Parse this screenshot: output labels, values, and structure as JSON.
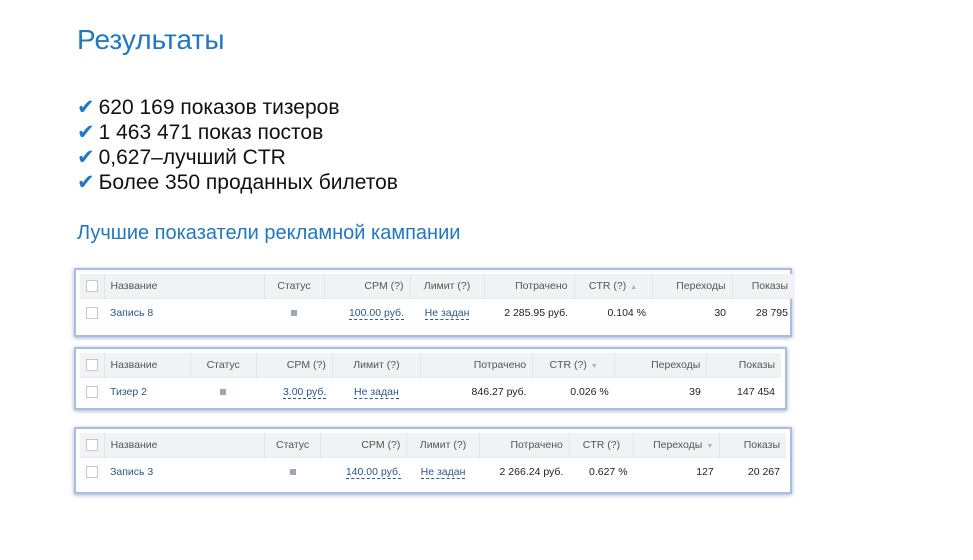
{
  "title": "Результаты",
  "bullets": [
    "620 169 показов тизеров",
    "1 463 471 показ постов",
    "0,627–лучший CTR",
    "Более 350 проданных билетов"
  ],
  "check_glyph": "✔",
  "subtitle": "Лучшие показатели рекламной кампании",
  "colors": {
    "accent": "#1f78c1",
    "link": "#2a5885",
    "panel_border": "#a9bde3"
  },
  "tables": [
    {
      "headers": [
        "Название",
        "Статус",
        "CPM (?)",
        "Лимит (?)",
        "Потрачено",
        "CTR (?)",
        "Переходы",
        "Показы"
      ],
      "sorted_column": "CTR (?)",
      "sort_glyph": "▲",
      "row": {
        "name": "Запись 8",
        "cpm": "100.00 руб.",
        "limit": "Не задан",
        "spent": "2 285.95 руб.",
        "ctr": "0.104 %",
        "clicks": "30",
        "views": "28 795"
      }
    },
    {
      "headers": [
        "Название",
        "Статус",
        "CPM (?)",
        "Лимит (?)",
        "Потрачено",
        "CTR (?)",
        "Переходы",
        "Показы"
      ],
      "sorted_column": "CTR (?)",
      "sort_glyph": "▼",
      "row": {
        "name": "Тизер 2",
        "cpm": "3.00 руб.",
        "limit": "Не задан",
        "spent": "846.27 руб.",
        "ctr": "0.026 %",
        "clicks": "39",
        "views": "147 454"
      }
    },
    {
      "headers": [
        "Название",
        "Статус",
        "CPM (?)",
        "Лимит (?)",
        "Потрачено",
        "CTR (?)",
        "Переходы",
        "Показы"
      ],
      "sorted_column": "Переходы",
      "sort_glyph": "▼",
      "row": {
        "name": "Запись 3",
        "cpm": "140.00 руб.",
        "limit": "Не задан",
        "spent": "2 266.24 руб.",
        "ctr": "0.627 %",
        "clicks": "127",
        "views": "20 267"
      }
    }
  ]
}
